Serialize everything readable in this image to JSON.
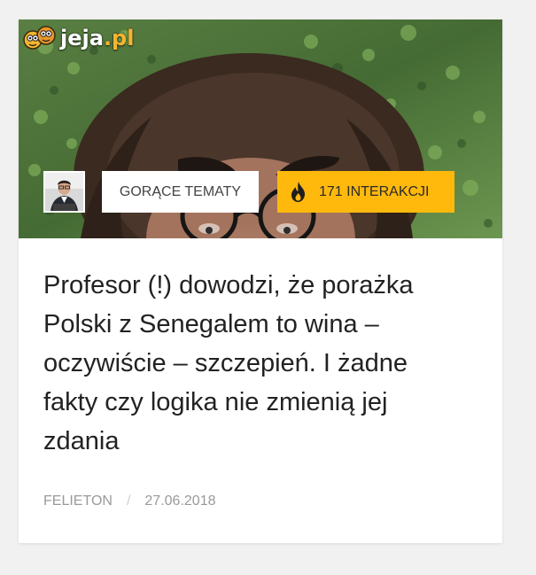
{
  "brand": {
    "logo_main": "jeja",
    "logo_suffix": ".pl"
  },
  "article": {
    "hot_label": "GORĄCE TEMATY",
    "interactions_label": "171 INTERAKCJI",
    "title": "Profesor (!) dowodzi, że porażka Polski z Senegalem to wina – oczywiście – szczepień. I żadne fakty czy logika nie zmienią jej zdania",
    "category": "FELIETON",
    "separator": "/",
    "date": "27.06.2018"
  },
  "icons": {
    "logo": "jeja-logo-icon",
    "avatar": "author-avatar",
    "interactions": "flame-icon"
  },
  "colors": {
    "interactions_badge": "#ffb90d",
    "logo_accent": "#f4b52f",
    "title_text": "#222222",
    "meta_text": "#9a9a9a"
  }
}
